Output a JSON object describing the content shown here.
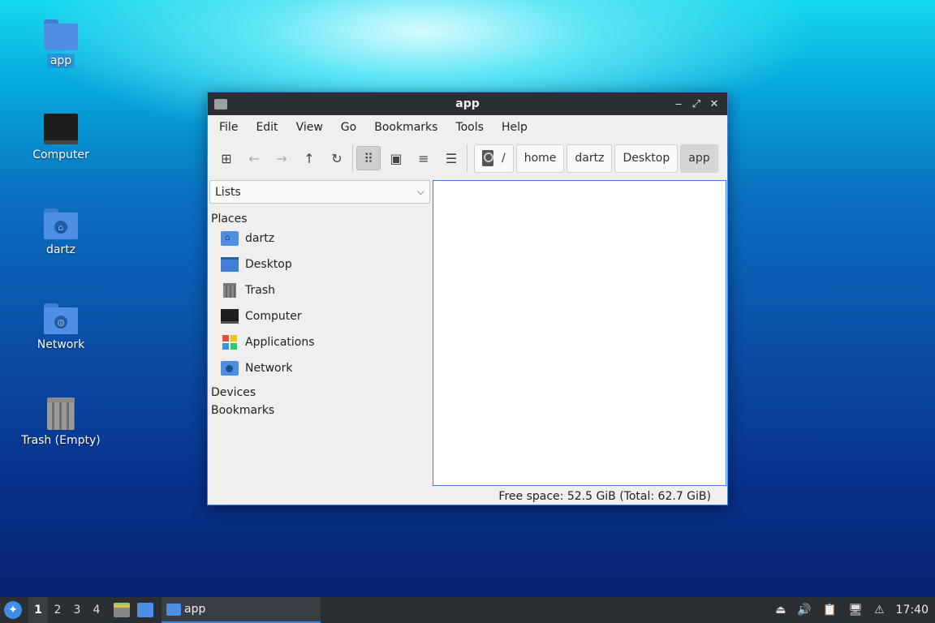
{
  "desktop": {
    "icons": [
      {
        "label": "app"
      },
      {
        "label": "Computer"
      },
      {
        "label": "dartz"
      },
      {
        "label": "Network"
      },
      {
        "label": "Trash (Empty)"
      }
    ]
  },
  "window": {
    "title": "app",
    "controls": {
      "minimize": "‒",
      "maximize": "⤢",
      "close": "✕"
    },
    "menu": [
      "File",
      "Edit",
      "View",
      "Go",
      "Bookmarks",
      "Tools",
      "Help"
    ],
    "toolbar": {
      "icons": [
        "new-tab-icon",
        "back-icon",
        "forward-icon",
        "up-icon",
        "reload-icon",
        "icon-view-icon",
        "thumbnail-view-icon",
        "compact-view-icon",
        "detailed-list-icon"
      ],
      "glyphs": {
        "new_tab": "⊞",
        "back": "←",
        "forward": "→",
        "up": "↑",
        "reload": "↻",
        "icon_view": "⠿",
        "thumb": "▣",
        "compact": "≡",
        "detailed": "☰"
      }
    },
    "path": {
      "root": "/",
      "segments": [
        "home",
        "dartz",
        "Desktop",
        "app"
      ]
    },
    "sidebar": {
      "mode": "Lists",
      "sections": {
        "places": "Places",
        "devices": "Devices",
        "bookmarks": "Bookmarks"
      },
      "places": [
        {
          "label": "dartz",
          "icon": "home-folder-icon"
        },
        {
          "label": "Desktop",
          "icon": "desktop-icon"
        },
        {
          "label": "Trash",
          "icon": "trash-icon"
        },
        {
          "label": "Computer",
          "icon": "computer-icon"
        },
        {
          "label": "Applications",
          "icon": "applications-icon"
        },
        {
          "label": "Network",
          "icon": "network-icon"
        }
      ]
    },
    "status": "Free space: 52.5 GiB (Total: 62.7 GiB)"
  },
  "taskbar": {
    "workspaces": [
      "1",
      "2",
      "3",
      "4"
    ],
    "task_label": "app",
    "clock": "17:40"
  }
}
